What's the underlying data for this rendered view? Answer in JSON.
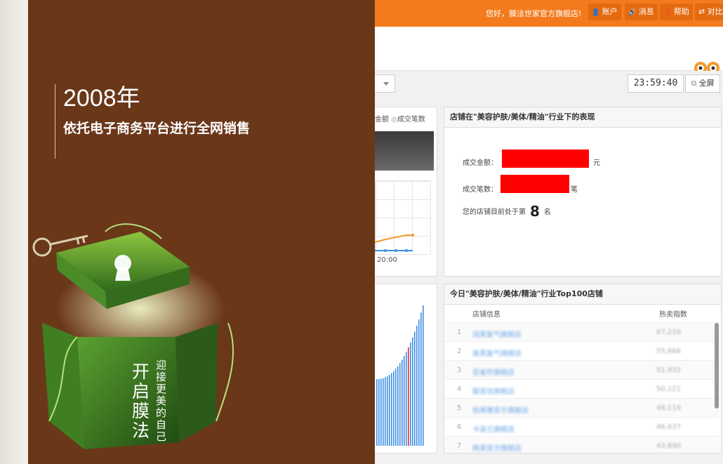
{
  "colors": {
    "brand_orange": "#f37b1d",
    "promo_brown": "#6a3719",
    "redaction": "#ff0000",
    "link_blue": "#6aa5e6"
  },
  "topbar": {
    "greeting": "您好，膜法世家官方旗舰店!",
    "buttons": [
      {
        "icon": "user-icon",
        "glyph": "👤",
        "label": "账户"
      },
      {
        "icon": "speaker-icon",
        "glyph": "🔊",
        "label": "消息"
      },
      {
        "icon": "help-icon",
        "glyph": "❓",
        "label": "帮助"
      },
      {
        "icon": "share-icon",
        "glyph": "⇄",
        "label": "对比"
      }
    ]
  },
  "toolbar": {
    "clock": "23:59:40",
    "fullscreen_label": "全屏"
  },
  "chart_panel": {
    "legend_amount": "金额",
    "legend_count": "成交笔数",
    "x_tick": "20:00"
  },
  "performance": {
    "title": "店铺在\"美容护肤/美体/精油\"行业下的表现",
    "amount_label": "成交金额：",
    "amount_unit": "元",
    "count_label": "成交笔数：",
    "count_unit": "笔",
    "rank_prefix": "您的店铺目前处于第",
    "rank_value": "8",
    "rank_suffix": "名"
  },
  "top100": {
    "title": "今日\"美容护肤/美体/精油\"行业Top100店铺",
    "col_shop": "店铺信息",
    "col_index": "热卖指数",
    "rows": [
      {
        "rank": "1",
        "name": "润芙复气旗舰店",
        "value": "67,220"
      },
      {
        "rank": "2",
        "name": "美芙复气旗舰店",
        "value": "55,666"
      },
      {
        "rank": "3",
        "name": "百雀羚旗舰店",
        "value": "51,932"
      },
      {
        "rank": "4",
        "name": "御泥坊旗舰店",
        "value": "50,121"
      },
      {
        "rank": "5",
        "name": "珀莱雅官方旗舰店",
        "value": "48,119"
      },
      {
        "rank": "6",
        "name": "卡姿兰旗舰店",
        "value": "46,637"
      },
      {
        "rank": "7",
        "name": "韩束官方旗舰店",
        "value": "43,890"
      }
    ]
  },
  "promo": {
    "year": "2008年",
    "slogan": "依托电子商务平台进行全网销售",
    "cube_title": "开启膜法",
    "cube_subtitle": "迎接更美的自己"
  }
}
